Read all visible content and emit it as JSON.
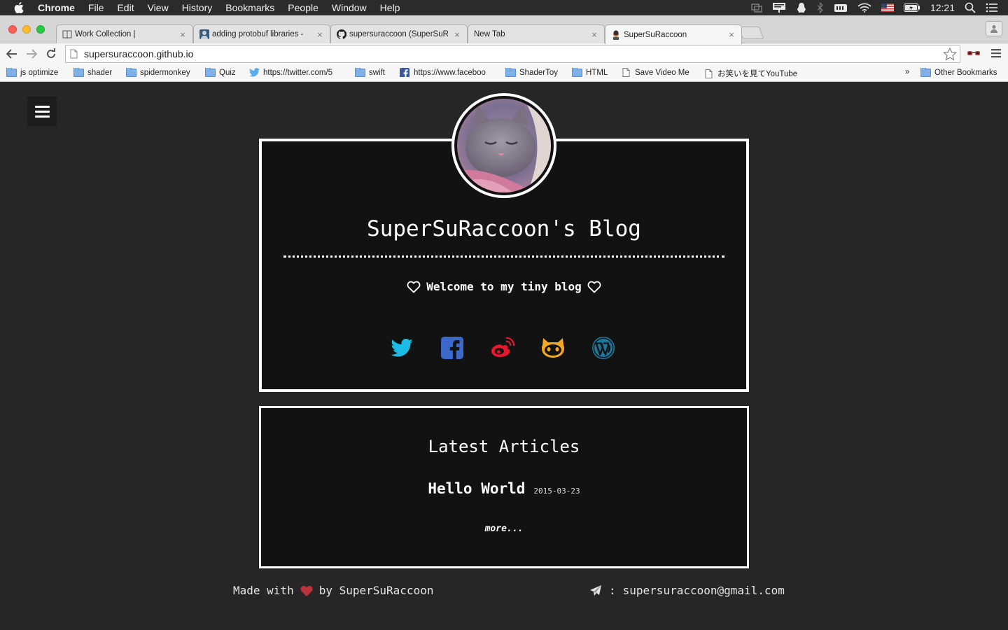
{
  "menubar": {
    "app": "Chrome",
    "items": [
      "File",
      "Edit",
      "View",
      "History",
      "Bookmarks",
      "People",
      "Window",
      "Help"
    ],
    "clock": "12:21"
  },
  "tabs": [
    {
      "title": "Work Collection |",
      "icon": "book-icon"
    },
    {
      "title": "adding protobuf libraries -",
      "icon": "stackoverflow-avatar-icon"
    },
    {
      "title": "supersuraccoon (SuperSuR",
      "icon": "github-icon"
    },
    {
      "title": "New Tab",
      "icon": ""
    },
    {
      "title": "SuperSuRaccoon",
      "icon": "raccoon-avatar-icon"
    }
  ],
  "toolbar": {
    "url": "supersuraccoon.github.io"
  },
  "bookmarks": [
    {
      "label": "js optimize",
      "icon": "folder-icon"
    },
    {
      "label": "shader",
      "icon": "folder-icon"
    },
    {
      "label": "spidermonkey",
      "icon": "folder-icon"
    },
    {
      "label": "Quiz",
      "icon": "folder-icon"
    },
    {
      "label": "https://twitter.com/5",
      "icon": "twitter-icon"
    },
    {
      "label": "swift",
      "icon": "folder-icon"
    },
    {
      "label": "https://www.faceboo",
      "icon": "facebook-icon"
    },
    {
      "label": "ShaderToy",
      "icon": "folder-icon"
    },
    {
      "label": "HTML",
      "icon": "folder-icon"
    },
    {
      "label": "Save Video Me",
      "icon": "page-icon"
    },
    {
      "label": "お笑いを見てYouTube",
      "icon": "page-icon"
    }
  ],
  "bookmarks_overflow": "»",
  "other_bookmarks": "Other Bookmarks",
  "page": {
    "blog_title": "SuperSuRaccoon's Blog",
    "welcome": "Welcome to my tiny blog",
    "social": [
      {
        "name": "twitter",
        "color": "#1da1f2"
      },
      {
        "name": "facebook",
        "color": "#3b5998"
      },
      {
        "name": "weibo",
        "color": "#e6162d"
      },
      {
        "name": "github",
        "color": "#f5a623"
      },
      {
        "name": "wordpress",
        "color": "#21759b"
      }
    ],
    "latest_heading": "Latest Articles",
    "articles": [
      {
        "title": "Hello World",
        "date": "2015-03-23"
      }
    ],
    "more": "more...",
    "footer": {
      "made_with": "Made with",
      "by": "by SuperSuRaccoon",
      "email_sep": ":",
      "email": "supersuraccoon@gmail.com"
    }
  }
}
